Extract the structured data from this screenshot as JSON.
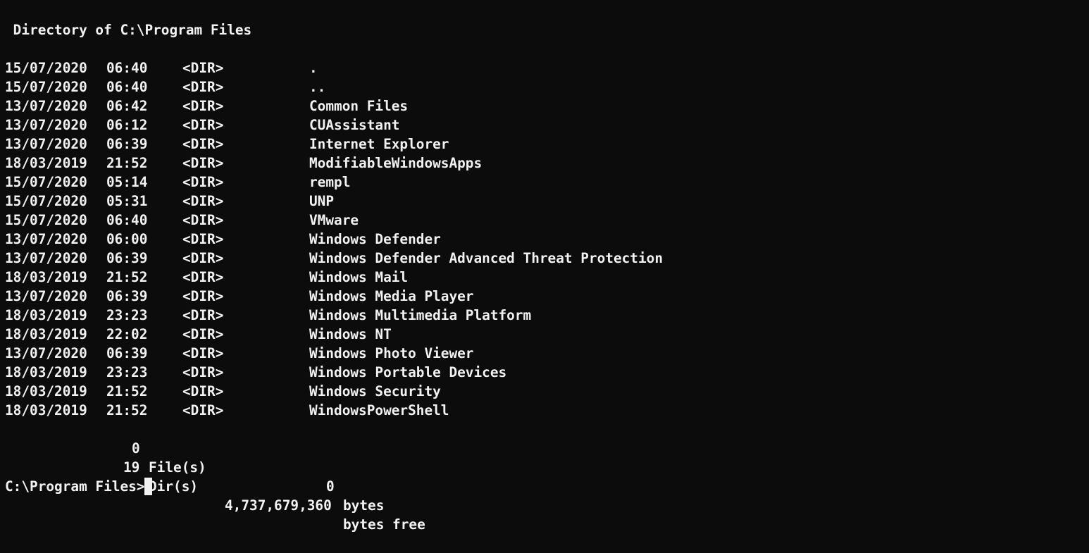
{
  "header": {
    "directory_line": " Directory of C:\\Program Files"
  },
  "entries": [
    {
      "date": "15/07/2020",
      "time": "06:40",
      "type": "<DIR>",
      "name": "."
    },
    {
      "date": "15/07/2020",
      "time": "06:40",
      "type": "<DIR>",
      "name": ".."
    },
    {
      "date": "13/07/2020",
      "time": "06:42",
      "type": "<DIR>",
      "name": "Common Files"
    },
    {
      "date": "13/07/2020",
      "time": "06:12",
      "type": "<DIR>",
      "name": "CUAssistant"
    },
    {
      "date": "13/07/2020",
      "time": "06:39",
      "type": "<DIR>",
      "name": "Internet Explorer"
    },
    {
      "date": "18/03/2019",
      "time": "21:52",
      "type": "<DIR>",
      "name": "ModifiableWindowsApps"
    },
    {
      "date": "15/07/2020",
      "time": "05:14",
      "type": "<DIR>",
      "name": "rempl"
    },
    {
      "date": "15/07/2020",
      "time": "05:31",
      "type": "<DIR>",
      "name": "UNP"
    },
    {
      "date": "15/07/2020",
      "time": "06:40",
      "type": "<DIR>",
      "name": "VMware"
    },
    {
      "date": "13/07/2020",
      "time": "06:00",
      "type": "<DIR>",
      "name": "Windows Defender"
    },
    {
      "date": "13/07/2020",
      "time": "06:39",
      "type": "<DIR>",
      "name": "Windows Defender Advanced Threat Protection"
    },
    {
      "date": "18/03/2019",
      "time": "21:52",
      "type": "<DIR>",
      "name": "Windows Mail"
    },
    {
      "date": "13/07/2020",
      "time": "06:39",
      "type": "<DIR>",
      "name": "Windows Media Player"
    },
    {
      "date": "18/03/2019",
      "time": "23:23",
      "type": "<DIR>",
      "name": "Windows Multimedia Platform"
    },
    {
      "date": "18/03/2019",
      "time": "22:02",
      "type": "<DIR>",
      "name": "Windows NT"
    },
    {
      "date": "13/07/2020",
      "time": "06:39",
      "type": "<DIR>",
      "name": "Windows Photo Viewer"
    },
    {
      "date": "18/03/2019",
      "time": "23:23",
      "type": "<DIR>",
      "name": "Windows Portable Devices"
    },
    {
      "date": "18/03/2019",
      "time": "21:52",
      "type": "<DIR>",
      "name": "Windows Security"
    },
    {
      "date": "18/03/2019",
      "time": "21:52",
      "type": "<DIR>",
      "name": "WindowsPowerShell"
    }
  ],
  "summary": {
    "files_count": "0",
    "files_label": "File(s)",
    "files_bytes": "0",
    "files_unit": "bytes",
    "dirs_count": "19",
    "dirs_label": "Dir(s)",
    "free_bytes": "4,737,679,360",
    "free_unit": "bytes free"
  },
  "prompt": {
    "text": "C:\\Program Files>"
  },
  "colors": {
    "background": "#0c0c0c",
    "foreground": "#f2f2f2"
  }
}
